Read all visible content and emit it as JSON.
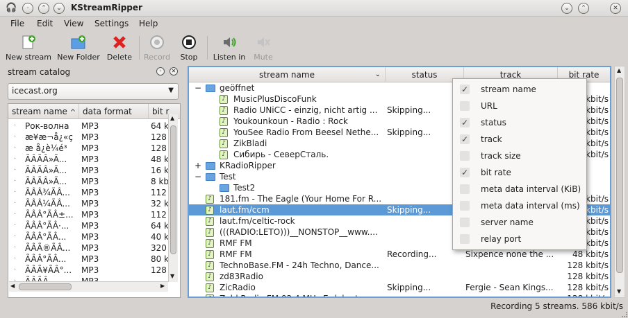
{
  "window": {
    "title": "KStreamRipper"
  },
  "menu": [
    "File",
    "Edit",
    "View",
    "Settings",
    "Help"
  ],
  "toolbar": [
    {
      "label": "New stream",
      "icon": "new-stream-icon",
      "enabled": true
    },
    {
      "label": "New Folder",
      "icon": "new-folder-icon",
      "enabled": true
    },
    {
      "label": "Delete",
      "icon": "delete-icon",
      "enabled": true
    },
    {
      "label": "Record",
      "icon": "record-icon",
      "enabled": false
    },
    {
      "label": "Stop",
      "icon": "stop-icon",
      "enabled": true
    },
    {
      "label": "Listen in",
      "icon": "speaker-icon",
      "enabled": true
    },
    {
      "label": "Mute",
      "icon": "mute-icon",
      "enabled": false
    }
  ],
  "catalog": {
    "title": "stream catalog",
    "source": "icecast.org",
    "columns": [
      "stream name",
      "data format",
      "bit r"
    ],
    "rows": [
      [
        "Рок-волна",
        "MP3",
        "64 k"
      ],
      [
        "æ¥æ¬å¿«ç",
        "MP3",
        "128"
      ],
      [
        "æ å¿è¼é³",
        "MP3",
        "128"
      ],
      [
        "ÃÂÃÂ»Ã...",
        "MP3",
        "48 k"
      ],
      [
        "ÃÂÃÂ»Ã...",
        "MP3",
        "16 k"
      ],
      [
        "ÃÂÃÂ»Ã...",
        "MP3",
        "8 kb"
      ],
      [
        "ÃÂÂ¾ÃÂ...",
        "MP3",
        "112"
      ],
      [
        "ÃÂÂ¼ÃÂ...",
        "MP3",
        "32 k"
      ],
      [
        "ÃÂÂ°ÃÂ±...",
        "MP3",
        "112"
      ],
      [
        "ÃÂÂ°ÃÂ·...",
        "MP3",
        "64 k"
      ],
      [
        "ÃÂÂ°ÃÂ...",
        "MP3",
        "40 k"
      ],
      [
        "ÃÂÃ®ÃÂ...",
        "MP3",
        "320"
      ],
      [
        "ÃÂÂ°ÃÂ...",
        "MP3",
        "80 k"
      ],
      [
        "ÃÂÃ¥ÃÂ°...",
        "MP3",
        "128"
      ],
      [
        "ÃÂÃÂ...",
        "MP3",
        "..."
      ]
    ]
  },
  "streams": {
    "columns": [
      "stream name",
      "status",
      "track",
      "bit rate"
    ],
    "rows": [
      {
        "kind": "folder",
        "level": 0,
        "expander": "−",
        "name": "geöffnet",
        "status": "",
        "track": "",
        "bitrate": ""
      },
      {
        "kind": "stream",
        "level": 1,
        "name": "MusicPlusDiscoFunk",
        "status": "",
        "track": "",
        "bitrate": "kbit/s"
      },
      {
        "kind": "stream",
        "level": 1,
        "name": "Radio UNiCC - einzig, nicht artig ...",
        "status": "Skipping...",
        "track": "",
        "bitrate": "kbit/s"
      },
      {
        "kind": "stream",
        "level": 1,
        "name": "Youkounkoun - Radio : Rock",
        "status": "",
        "track": "",
        "bitrate": "kbit/s"
      },
      {
        "kind": "stream",
        "level": 1,
        "name": "YouSee Radio From Beesel Nethe...",
        "status": "Skipping...",
        "track": "",
        "bitrate": "kbit/s"
      },
      {
        "kind": "stream",
        "level": 1,
        "name": "ZikBladi",
        "status": "",
        "track": "",
        "bitrate": "kbit/s"
      },
      {
        "kind": "stream",
        "level": 1,
        "name": "Сибирь - СеверСталь.",
        "status": "",
        "track": "",
        "bitrate": "kbit/s"
      },
      {
        "kind": "folder",
        "level": 0,
        "expander": "+",
        "name": "KRadioRipper",
        "status": "",
        "track": "",
        "bitrate": ""
      },
      {
        "kind": "folder",
        "level": 0,
        "expander": "−",
        "name": "Test",
        "status": "",
        "track": "",
        "bitrate": ""
      },
      {
        "kind": "folder",
        "level": 1,
        "expander": "",
        "name": "Test2",
        "status": "",
        "track": "",
        "bitrate": ""
      },
      {
        "kind": "stream",
        "level": 0,
        "name": "181.fm - The Eagle (Your Home For R...",
        "status": "",
        "track": "",
        "bitrate": "kbit/s"
      },
      {
        "kind": "stream",
        "level": 0,
        "name": "laut.fm/ccm",
        "status": "Skipping...",
        "track": "",
        "bitrate": "kbit/s",
        "selected": true
      },
      {
        "kind": "stream",
        "level": 0,
        "name": "laut.fm/celtic-rock",
        "status": "",
        "track": "",
        "bitrate": "kbit/s"
      },
      {
        "kind": "stream",
        "level": 0,
        "name": "(((RADIO:LETO)))__NONSTOP__www....",
        "status": "",
        "track": "",
        "bitrate": "kbit/s"
      },
      {
        "kind": "stream",
        "level": 0,
        "name": "RMF FM",
        "status": "",
        "track": "",
        "bitrate": "kbit/s"
      },
      {
        "kind": "stream",
        "level": 0,
        "name": "RMF FM",
        "status": "Recording...",
        "track": "Sixpence none the ...",
        "bitrate": "48 kbit/s"
      },
      {
        "kind": "stream",
        "level": 0,
        "name": "TechnoBase.FM - 24h Techno, Dance...",
        "status": "",
        "track": "",
        "bitrate": "128 kbit/s"
      },
      {
        "kind": "stream",
        "level": 0,
        "name": "zd83Radio",
        "status": "",
        "track": "",
        "bitrate": "128 kbit/s"
      },
      {
        "kind": "stream",
        "level": 0,
        "name": "ZicRadio",
        "status": "Skipping...",
        "track": "Fergie - Sean Kings...",
        "bitrate": "128 kbit/s"
      },
      {
        "kind": "stream",
        "level": 0,
        "name": "Zeld Radio FM 92.4 MHz Erdekertes...",
        "status": "",
        "track": "",
        "bitrate": "128 kbit/s"
      }
    ]
  },
  "column_menu": [
    {
      "label": "stream name",
      "checked": true
    },
    {
      "label": "URL",
      "checked": false
    },
    {
      "label": "status",
      "checked": true
    },
    {
      "label": "track",
      "checked": true
    },
    {
      "label": "track size",
      "checked": false
    },
    {
      "label": "bit rate",
      "checked": true
    },
    {
      "label": "meta data interval (KiB)",
      "checked": false
    },
    {
      "label": "meta data interval (ms)",
      "checked": false
    },
    {
      "label": "server name",
      "checked": false
    },
    {
      "label": "relay port",
      "checked": false
    }
  ],
  "status": {
    "text": "Recording 5 streams. 586 kbit/s"
  },
  "colors": {
    "selection": "#5b9ad6",
    "focus_border": "#6a9fd6",
    "folder": "#6aa4e0"
  }
}
